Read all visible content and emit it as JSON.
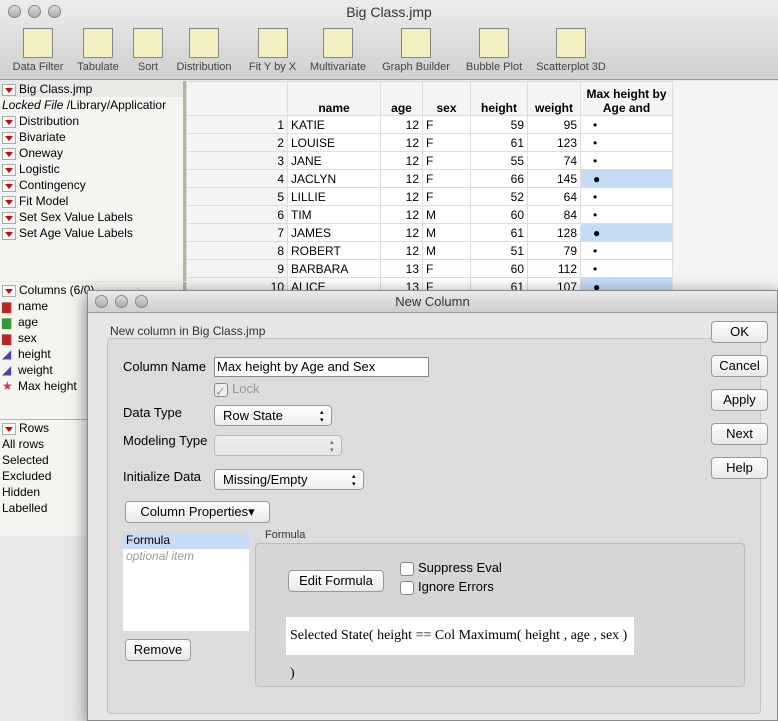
{
  "window": {
    "title": "Big Class.jmp"
  },
  "toolbar": [
    "Data Filter",
    "Tabulate",
    "Sort",
    "Distribution",
    "Fit Y by X",
    "Multivariate",
    "Graph Builder",
    "Bubble Plot",
    "Scatterplot 3D"
  ],
  "left": {
    "title": "Big Class.jmp",
    "locked": "Locked File",
    "path": "/Library/Applicatior",
    "scripts": [
      "Distribution",
      "Bivariate",
      "Oneway",
      "Logistic",
      "Contingency",
      "Fit Model",
      "Set Sex Value Labels",
      "Set Age Value Labels"
    ]
  },
  "columns": {
    "title": "Columns (6/0)",
    "items": [
      "name",
      "age",
      "sex",
      "height",
      "weight",
      "Max height"
    ]
  },
  "rows": {
    "title": "Rows",
    "items": [
      "All rows",
      "Selected",
      "Excluded",
      "Hidden",
      "Labelled"
    ]
  },
  "grid": {
    "headers": [
      "name",
      "age",
      "sex",
      "height",
      "weight",
      "Max height by Age and"
    ],
    "rows": [
      [
        "1",
        "KATIE",
        "12",
        "F",
        "59",
        "95",
        "•",
        false
      ],
      [
        "2",
        "LOUISE",
        "12",
        "F",
        "61",
        "123",
        "•",
        false
      ],
      [
        "3",
        "JANE",
        "12",
        "F",
        "55",
        "74",
        "•",
        false
      ],
      [
        "4",
        "JACLYN",
        "12",
        "F",
        "66",
        "145",
        "●",
        true
      ],
      [
        "5",
        "LILLIE",
        "12",
        "F",
        "52",
        "64",
        "•",
        false
      ],
      [
        "6",
        "TIM",
        "12",
        "M",
        "60",
        "84",
        "•",
        false
      ],
      [
        "7",
        "JAMES",
        "12",
        "M",
        "61",
        "128",
        "●",
        true
      ],
      [
        "8",
        "ROBERT",
        "12",
        "M",
        "51",
        "79",
        "•",
        false
      ],
      [
        "9",
        "BARBARA",
        "13",
        "F",
        "60",
        "112",
        "•",
        false
      ],
      [
        "10",
        "ALICE",
        "13",
        "F",
        "61",
        "107",
        "●",
        true
      ]
    ]
  },
  "dialog": {
    "title": "New Column",
    "subtitle": "New column in Big Class.jmp",
    "column_name_label": "Column Name",
    "column_name": "Max height by Age and Sex",
    "lock": "Lock",
    "data_type_label": "Data Type",
    "data_type": "Row State",
    "modeling_type_label": "Modeling Type",
    "modeling_type": "",
    "init_label": "Initialize Data",
    "init": "Missing/Empty",
    "col_props": "Column Properties",
    "props": [
      "Formula",
      "optional item"
    ],
    "remove": "Remove",
    "formula_group": "Formula",
    "edit_formula": "Edit Formula",
    "suppress": "Suppress Eval",
    "ignore": "Ignore Errors",
    "formula": "Selected State( height == Col Maximum( height , age , sex ) )",
    "buttons": [
      "OK",
      "Cancel",
      "Apply",
      "Next",
      "Help"
    ]
  }
}
